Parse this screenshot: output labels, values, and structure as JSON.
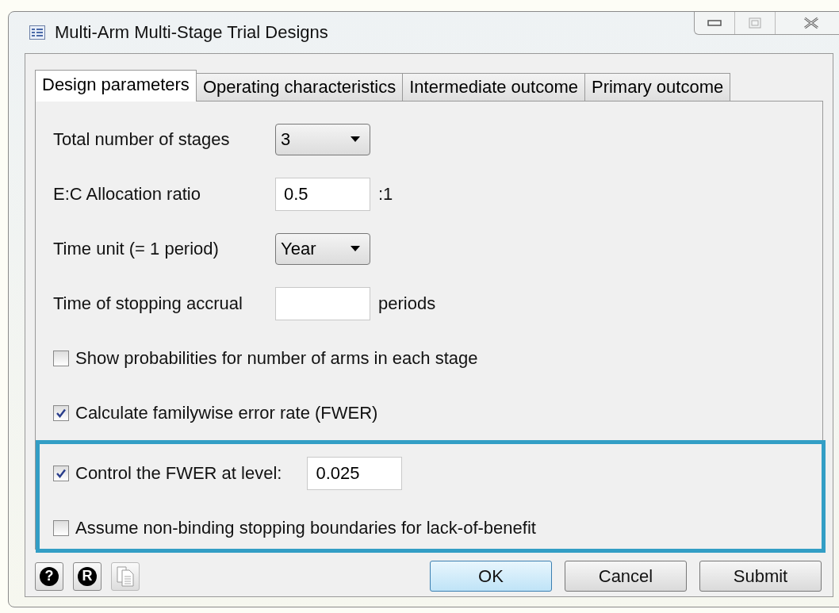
{
  "window": {
    "title": "Multi-Arm Multi-Stage Trial Designs"
  },
  "tabs": [
    {
      "label": "Design parameters",
      "selected": true
    },
    {
      "label": "Operating characteristics",
      "selected": false
    },
    {
      "label": "Intermediate outcome",
      "selected": false
    },
    {
      "label": "Primary outcome",
      "selected": false
    }
  ],
  "fields": [
    {
      "kind": "dropdown",
      "label": "Total number of stages",
      "value": "3"
    },
    {
      "kind": "text",
      "label": "E:C Allocation ratio",
      "value": "0.5",
      "suffix": ":1"
    },
    {
      "kind": "dropdown",
      "label": "Time unit (= 1 period)",
      "value": "Year"
    },
    {
      "kind": "text",
      "label": "Time of stopping accrual",
      "suffix": "periods"
    },
    {
      "kind": "checkbox",
      "label": "Show probabilities for number of arms in each stage",
      "checked": false
    },
    {
      "kind": "checkbox",
      "label": "Calculate familywise error rate (FWER)",
      "checked": true
    }
  ],
  "highlighted_fields": [
    {
      "kind": "checkbox",
      "label": "Control the FWER at level:",
      "checked": true,
      "value": "0.025"
    },
    {
      "kind": "checkbox",
      "label": "Assume non-binding stopping boundaries for lack-of-benefit",
      "checked": false
    }
  ],
  "footer_icons": [
    {
      "kind": "help",
      "glyph": "?"
    },
    {
      "kind": "r",
      "glyph": "R"
    },
    {
      "kind": "copy",
      "disabled": true
    }
  ],
  "buttons": [
    {
      "label": "OK",
      "default": true
    },
    {
      "label": "Cancel",
      "default": false
    },
    {
      "label": "Submit",
      "default": false
    }
  ]
}
